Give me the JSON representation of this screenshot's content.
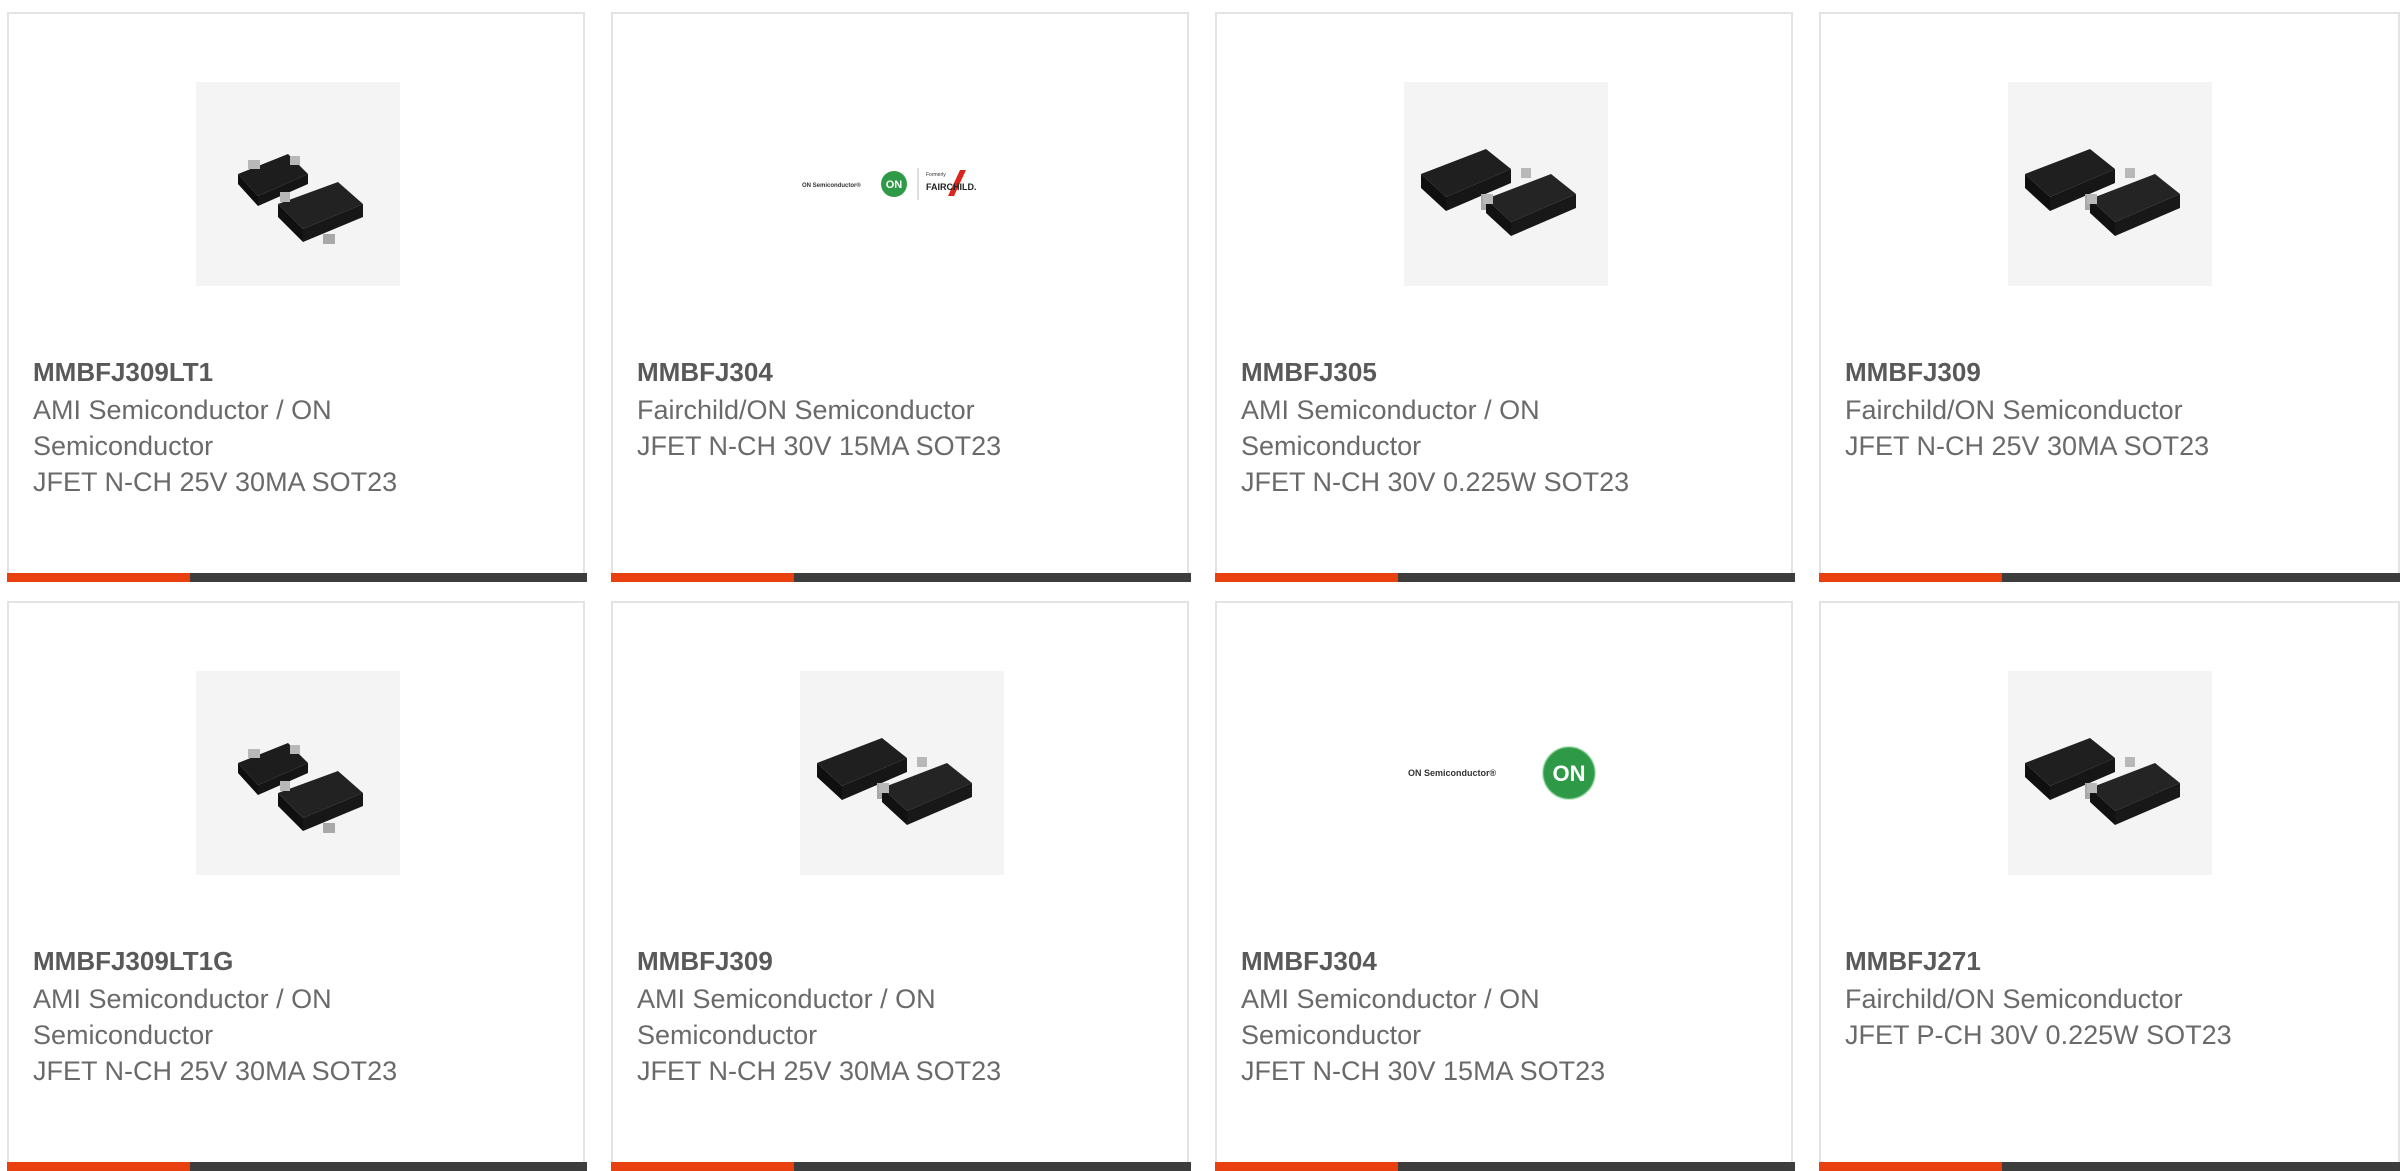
{
  "colors": {
    "accent": "#e8400e",
    "bar": "#3d3d3d",
    "border": "#e3e3e3",
    "text": "#6a6a6a",
    "title": "#595959",
    "on_green": "#2e9a48",
    "fairchild_red": "#d9261c"
  },
  "products": [
    {
      "part": "MMBFJ309LT1",
      "maker": "AMI Semiconductor / ON Semiconductor",
      "desc": "JFET N-CH 25V 30MA SOT23",
      "image": "sot23-package-icon"
    },
    {
      "part": "MMBFJ304",
      "maker": "Fairchild/ON Semiconductor",
      "desc": "JFET N-CH 30V 15MA SOT23",
      "image": "on-fairchild-logo",
      "logo": {
        "left_text": "ON Semiconductor®",
        "circle": "ON",
        "formerly": "Formerly",
        "brand": "FAIRCHILD."
      }
    },
    {
      "part": "MMBFJ305",
      "maker": "AMI Semiconductor / ON Semiconductor",
      "desc": "JFET N-CH 30V 0.225W SOT23",
      "image": "sot23-package-icon"
    },
    {
      "part": "MMBFJ309",
      "maker": "Fairchild/ON Semiconductor",
      "desc": "JFET N-CH 25V 30MA SOT23",
      "image": "sot23-package-icon"
    },
    {
      "part": "MMBFJ309LT1G",
      "maker": "AMI Semiconductor / ON Semiconductor",
      "desc": "JFET N-CH 25V 30MA SOT23",
      "image": "sot23-package-icon"
    },
    {
      "part": "MMBFJ309",
      "maker": "AMI Semiconductor / ON Semiconductor",
      "desc": "JFET N-CH 25V 30MA SOT23",
      "image": "sot23-package-icon"
    },
    {
      "part": "MMBFJ304",
      "maker": "AMI Semiconductor / ON Semiconductor",
      "desc": "JFET N-CH 30V 15MA SOT23",
      "image": "on-semiconductor-logo",
      "logo": {
        "left_text": "ON Semiconductor®",
        "circle": "ON"
      }
    },
    {
      "part": "MMBFJ271",
      "maker": "Fairchild/ON Semiconductor",
      "desc": "JFET P-CH 30V 0.225W SOT23",
      "image": "sot23-package-icon"
    }
  ]
}
